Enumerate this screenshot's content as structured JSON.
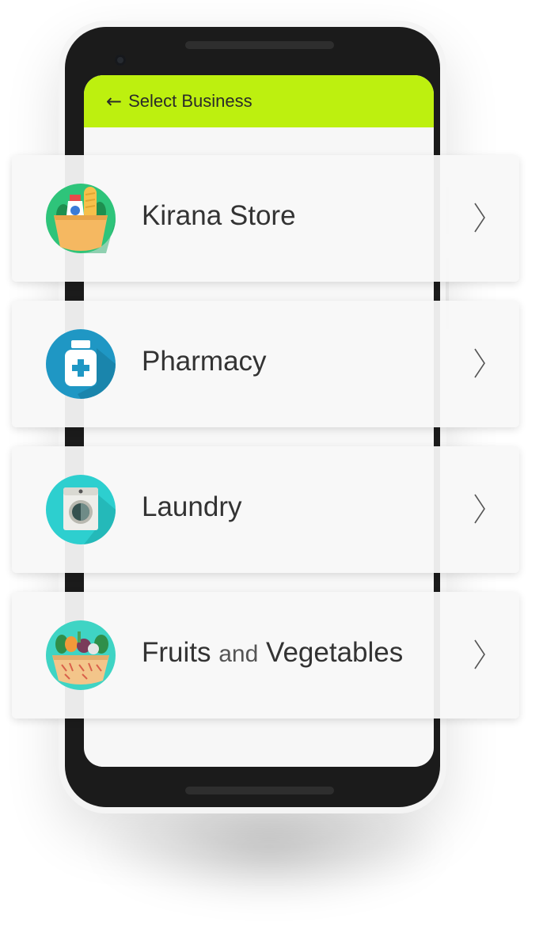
{
  "header": {
    "back_icon": "arrow-left-icon",
    "title": "Select Business",
    "background": "#bdf00f"
  },
  "business_list": [
    {
      "label": "Kirana Store",
      "icon": "grocery-bag-icon"
    },
    {
      "label": "Pharmacy",
      "icon": "medicine-bottle-icon"
    },
    {
      "label": "Laundry",
      "icon": "washing-machine-icon"
    },
    {
      "label_parts": [
        "Fruits",
        "and",
        "Vegetables"
      ],
      "icon": "vegetable-basket-icon"
    }
  ],
  "chevron_icon": "chevron-right-icon",
  "colors": {
    "accent": "#bdf00f",
    "kirana_icon_bg": "#2ec47a",
    "pharmacy_icon_bg": "#1f97c4",
    "laundry_icon_bg": "#2dcfcf",
    "fruits_icon_bg": "#3fd4c4"
  }
}
